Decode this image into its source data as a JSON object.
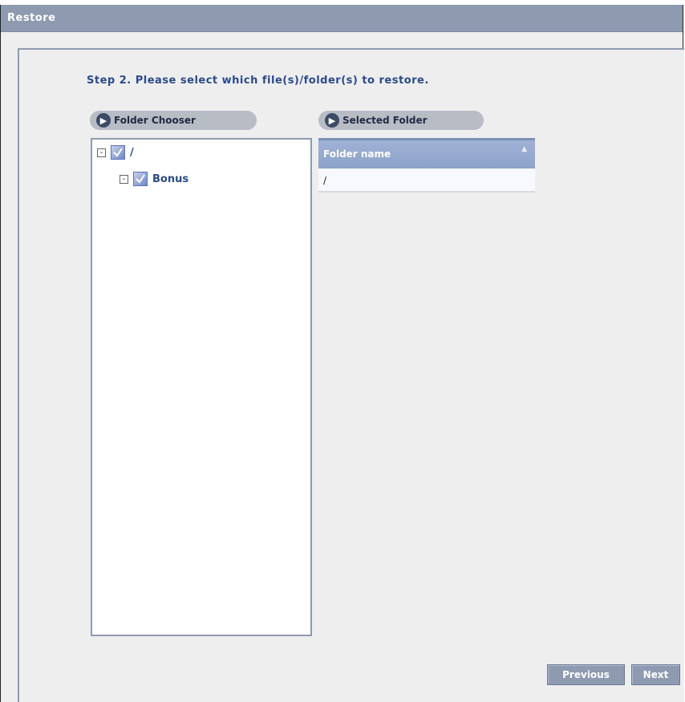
{
  "window": {
    "title": "Restore"
  },
  "step": {
    "text": "Step 2. Please select which file(s)/folder(s) to restore."
  },
  "panels": {
    "folder_chooser": {
      "label": "Folder Chooser",
      "icon": "arrow-circle-icon"
    },
    "selected_folder": {
      "label": "Selected Folder",
      "icon": "arrow-circle-icon"
    }
  },
  "tree": {
    "root": {
      "label": "/",
      "expander": "-",
      "checked": true
    },
    "child": {
      "label": "Bonus",
      "expander": "-",
      "checked": true
    }
  },
  "table": {
    "header": "Folder name",
    "rows": [
      "/"
    ]
  },
  "buttons": {
    "previous": "Previous",
    "next": "Next"
  },
  "colors": {
    "titlebar": "#8e9ab0",
    "accent_text": "#2b4a8a",
    "header": "#9fb2d6",
    "button": "#8e9ab0"
  }
}
